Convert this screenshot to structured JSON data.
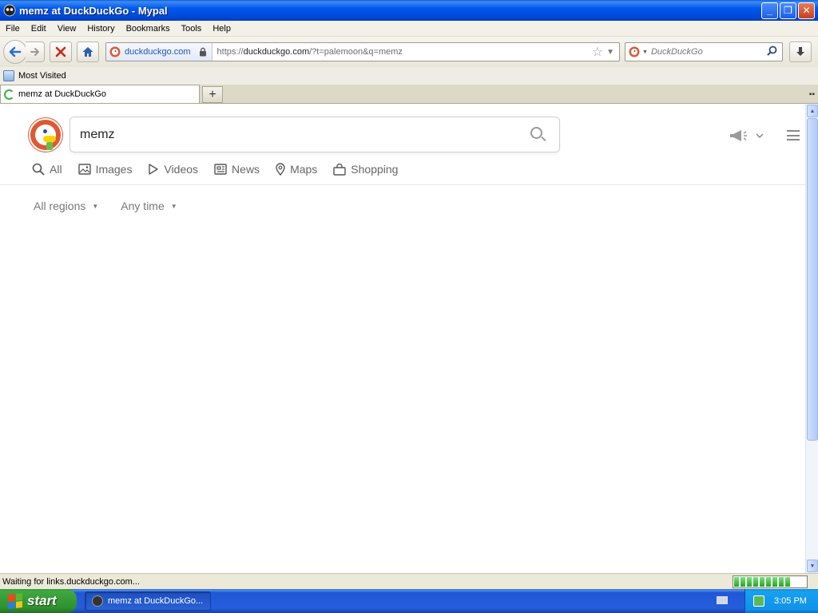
{
  "window": {
    "title": "memz at DuckDuckGo - Mypal",
    "minimize_label": "_",
    "restore_label": "❐",
    "close_label": "✕"
  },
  "menu": {
    "items": [
      "File",
      "Edit",
      "View",
      "History",
      "Bookmarks",
      "Tools",
      "Help"
    ]
  },
  "navbar": {
    "identity_label": "duckduckgo.com",
    "url_prefix": "https://",
    "url_host": "duckduckgo.com",
    "url_rest": "/?t=palemoon&q=memz",
    "search_placeholder": "DuckDuckGo"
  },
  "bookmarks": {
    "items": [
      "Most Visited"
    ]
  },
  "tabs": {
    "active_tab": "memz at DuckDuckGo",
    "new_tab_label": "+"
  },
  "page": {
    "search_query": "memz",
    "verticals": [
      {
        "label": "All",
        "icon": "search-icon"
      },
      {
        "label": "Images",
        "icon": "image-icon"
      },
      {
        "label": "Videos",
        "icon": "play-icon"
      },
      {
        "label": "News",
        "icon": "news-icon"
      },
      {
        "label": "Maps",
        "icon": "map-pin-icon"
      },
      {
        "label": "Shopping",
        "icon": "shopping-bag-icon"
      }
    ],
    "filters": [
      "All regions",
      "Any time"
    ],
    "accent_color": "#de5833"
  },
  "status": {
    "text": "Waiting for links.duckduckgo.com...",
    "progress_fraction": 0.85
  },
  "taskbar": {
    "start_label": "start",
    "task_label": "memz at DuckDuckGo...",
    "clock": "3:05 PM"
  }
}
